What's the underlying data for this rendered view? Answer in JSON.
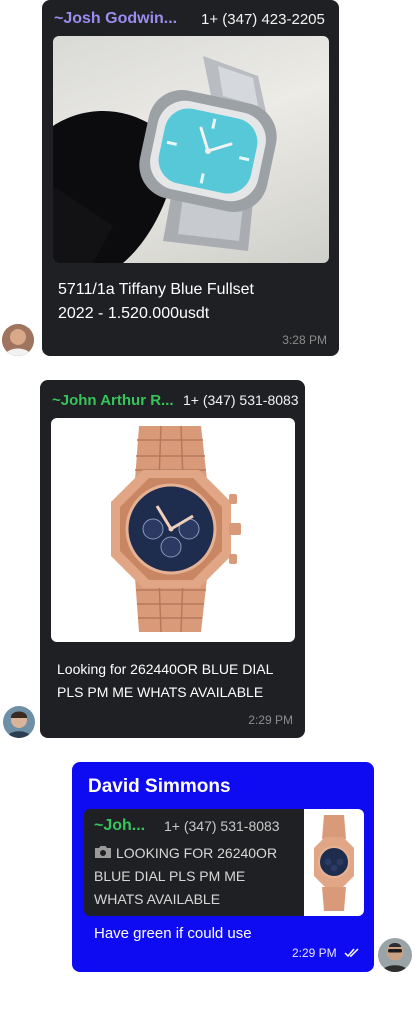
{
  "messages": [
    {
      "sender": "~Josh Godwin...",
      "phone": "1+ (347) 423-2205",
      "text_line1": "5711/1a Tiffany Blue Fullset",
      "text_line2": "2022 - 1.520.000usdt",
      "time": "3:28 PM"
    },
    {
      "sender": "~John Arthur R...",
      "phone": "1+ (347) 531-8083",
      "text_line1": "Looking for 262440OR BLUE DIAL",
      "text_line2": "PLS PM ME WHATS AVAILABLE",
      "time": "2:29 PM"
    }
  ],
  "reply": {
    "author": "David Simmons",
    "quoted_sender": "~Joh...",
    "quoted_phone": "1+ (347) 531-8083",
    "quoted_line1": "LOOKING FOR 26240OR",
    "quoted_line2": "BLUE DIAL PLS PM ME",
    "quoted_line3": "WHATS AVAILABLE",
    "text": "Have green if could use",
    "time": "2:29 PM",
    "status_icon": "double-check-icon"
  },
  "colors": {
    "bubble_bg": "#1f2023",
    "josh_name": "#9b8cf0",
    "john_name": "#37c45b",
    "reply_bg": "#0e0af2",
    "time": "#8c8c8c"
  }
}
